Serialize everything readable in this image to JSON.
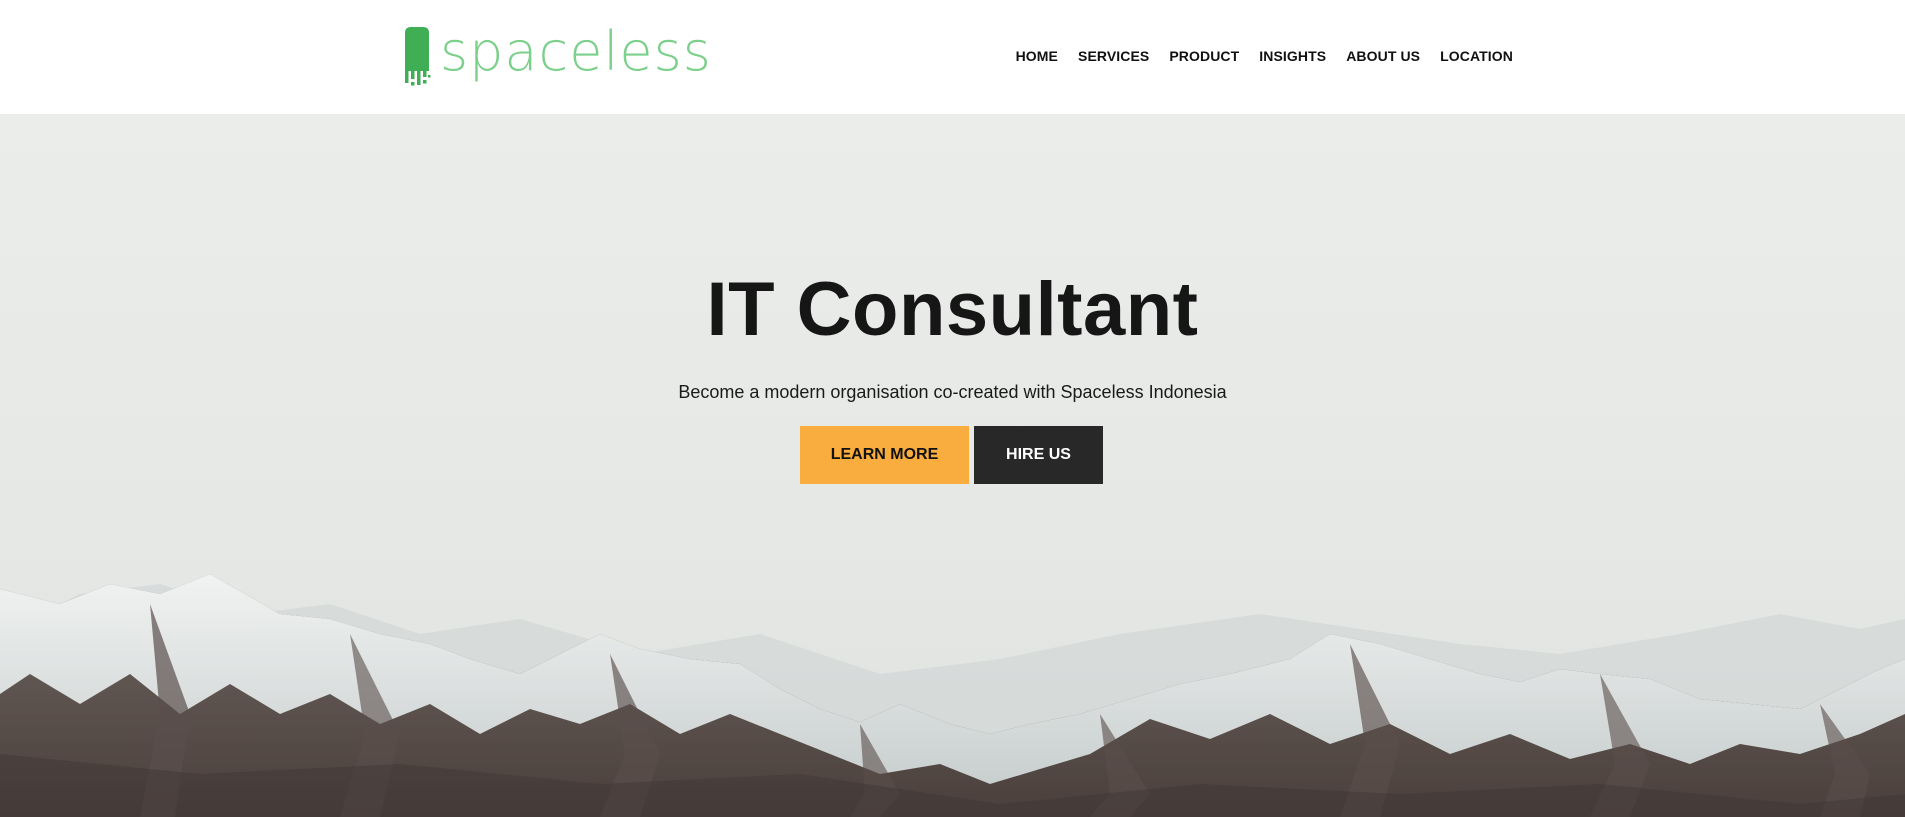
{
  "brand": {
    "name": "spaceless",
    "color": "#7dcf8c",
    "mark_color": "#3fae54",
    "logo_icon": "spaceless-logo-icon"
  },
  "nav": {
    "items": [
      {
        "label": "HOME"
      },
      {
        "label": "SERVICES"
      },
      {
        "label": "PRODUCT"
      },
      {
        "label": "INSIGHTS"
      },
      {
        "label": "ABOUT US"
      },
      {
        "label": "LOCATION"
      }
    ]
  },
  "hero": {
    "title": "IT Consultant",
    "subtitle": "Become a modern organisation co-created with Spaceless Indonesia",
    "primary_button": "LEARN MORE",
    "secondary_button": "HIRE US",
    "background_image": "snowy-mountain-range",
    "colors": {
      "sky": "#eceeeb",
      "primary_button": "#f9ad3e",
      "secondary_button": "#282828"
    }
  }
}
